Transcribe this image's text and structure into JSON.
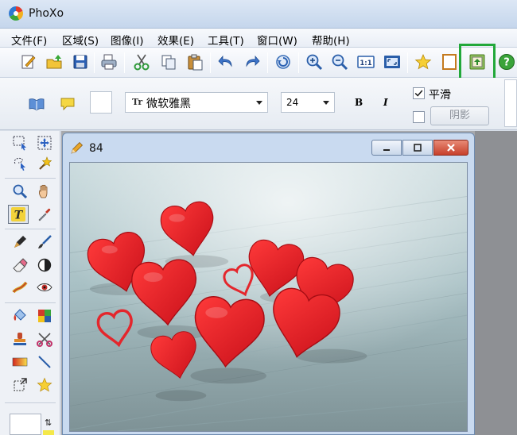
{
  "app": {
    "title": "PhoXo"
  },
  "menu": [
    {
      "id": "file",
      "label": "文件(F)"
    },
    {
      "id": "region",
      "label": "区域(S)"
    },
    {
      "id": "image",
      "label": "图像(I)"
    },
    {
      "id": "effects",
      "label": "效果(E)"
    },
    {
      "id": "tools",
      "label": "工具(T)"
    },
    {
      "id": "window",
      "label": "窗口(W)"
    },
    {
      "id": "help",
      "label": "帮助(H)"
    }
  ],
  "textbar": {
    "font_name": "微软雅黑",
    "font_type_badge": "Tr",
    "font_size": "24",
    "bold_label": "B",
    "italic_label": "I",
    "smooth_label": "平滑",
    "smooth_checked": true,
    "shadow_checked": false,
    "shadow_label": "阴影"
  },
  "document": {
    "title": "84"
  },
  "colors": {
    "highlight": "#22a83a",
    "heart": "#e4262c",
    "active_tool": "#f3d23a"
  },
  "icons": {
    "toolbar": [
      "new-icon",
      "open-icon",
      "save-icon",
      "print-icon",
      "cut-icon",
      "copy-icon",
      "paste-icon",
      "undo-icon",
      "redo-icon",
      "refresh-icon",
      "zoom-in-icon",
      "zoom-out-icon",
      "actual-size-icon",
      "fit-window-icon",
      "favorite-icon",
      "frame-icon",
      "export-icon",
      "help-icon"
    ],
    "palette": [
      "rect-select-icon",
      "move-select-icon",
      "lasso-icon",
      "magic-wand-icon",
      "zoom-tool-icon",
      "hand-tool-icon",
      "text-tool-icon",
      "eyedropper-icon",
      "pen-icon",
      "brush-icon",
      "eraser-icon",
      "contrast-icon",
      "smudge-icon",
      "eye-icon",
      "fill-icon",
      "color-replace-icon",
      "stamp-icon",
      "clone-icon",
      "gradient-icon",
      "line-tool-icon",
      "transform-icon",
      "star-icon"
    ]
  }
}
